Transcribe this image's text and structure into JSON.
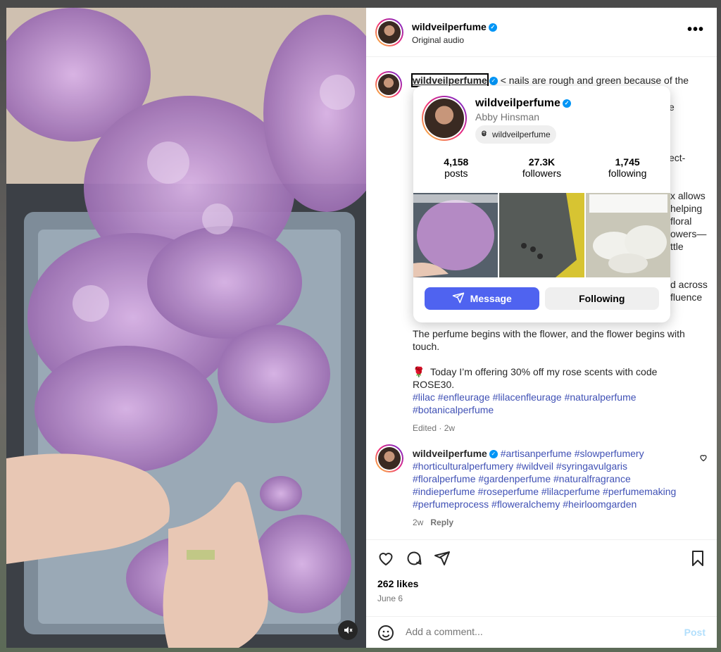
{
  "post": {
    "username": "wildveilperfume",
    "audio_label": "Original audio",
    "more_label": "•••",
    "caption_start": "< nails are rough and green because of the",
    "caption_fragments": {
      "f1": "e",
      "f2": "ect-",
      "f3": "x allows",
      "f4": "helping",
      "f5": "floral",
      "f6": "owers—",
      "f7": "ttle",
      "f8": "d across",
      "f9": "fluence"
    },
    "caption_closing": "The perfume begins with the flower, and the flower begins with touch.",
    "offer_icon": "🌹",
    "offer_text": "Today I’m offering 30% off my rose scents with code ROSE30.",
    "hashtags_line1": "#lilac #enfleurage #lilacenfleurage #naturalperfume",
    "hashtags_line2": "#botanicalperfume",
    "edited_meta": "Edited · 2w"
  },
  "comment": {
    "username": "wildveilperfume",
    "text": "#artisanperfume #slowperfumery #horticulturalperfumery #wildveil #syringavulgaris #floralperfume #gardenperfume #naturalfragrance #indieperfume #roseperfume #lilacperfume #perfumemaking #perfumeprocess #floweralchemy #heirloomgarden",
    "time": "2w",
    "reply_label": "Reply"
  },
  "actions": {
    "likes": "262 likes",
    "date": "June 6"
  },
  "add_comment": {
    "placeholder": "Add a comment...",
    "post_label": "Post"
  },
  "hover_card": {
    "username": "wildveilperfume",
    "full_name": "Abby Hinsman",
    "threads_handle": "wildveilperfume",
    "stats": [
      {
        "value": "4,158",
        "label": "posts"
      },
      {
        "value": "27.3K",
        "label": "followers"
      },
      {
        "value": "1,745",
        "label": "following"
      }
    ],
    "message_label": "Message",
    "following_label": "Following"
  },
  "colors": {
    "accent": "#4f63f0",
    "hashtag": "#4051b5",
    "verified": "#0095f6"
  },
  "icons": [
    "verified-icon",
    "more-icon",
    "heart-icon",
    "comment-icon",
    "share-icon",
    "bookmark-icon",
    "emoji-icon",
    "threads-icon",
    "send-icon",
    "mute-icon"
  ]
}
